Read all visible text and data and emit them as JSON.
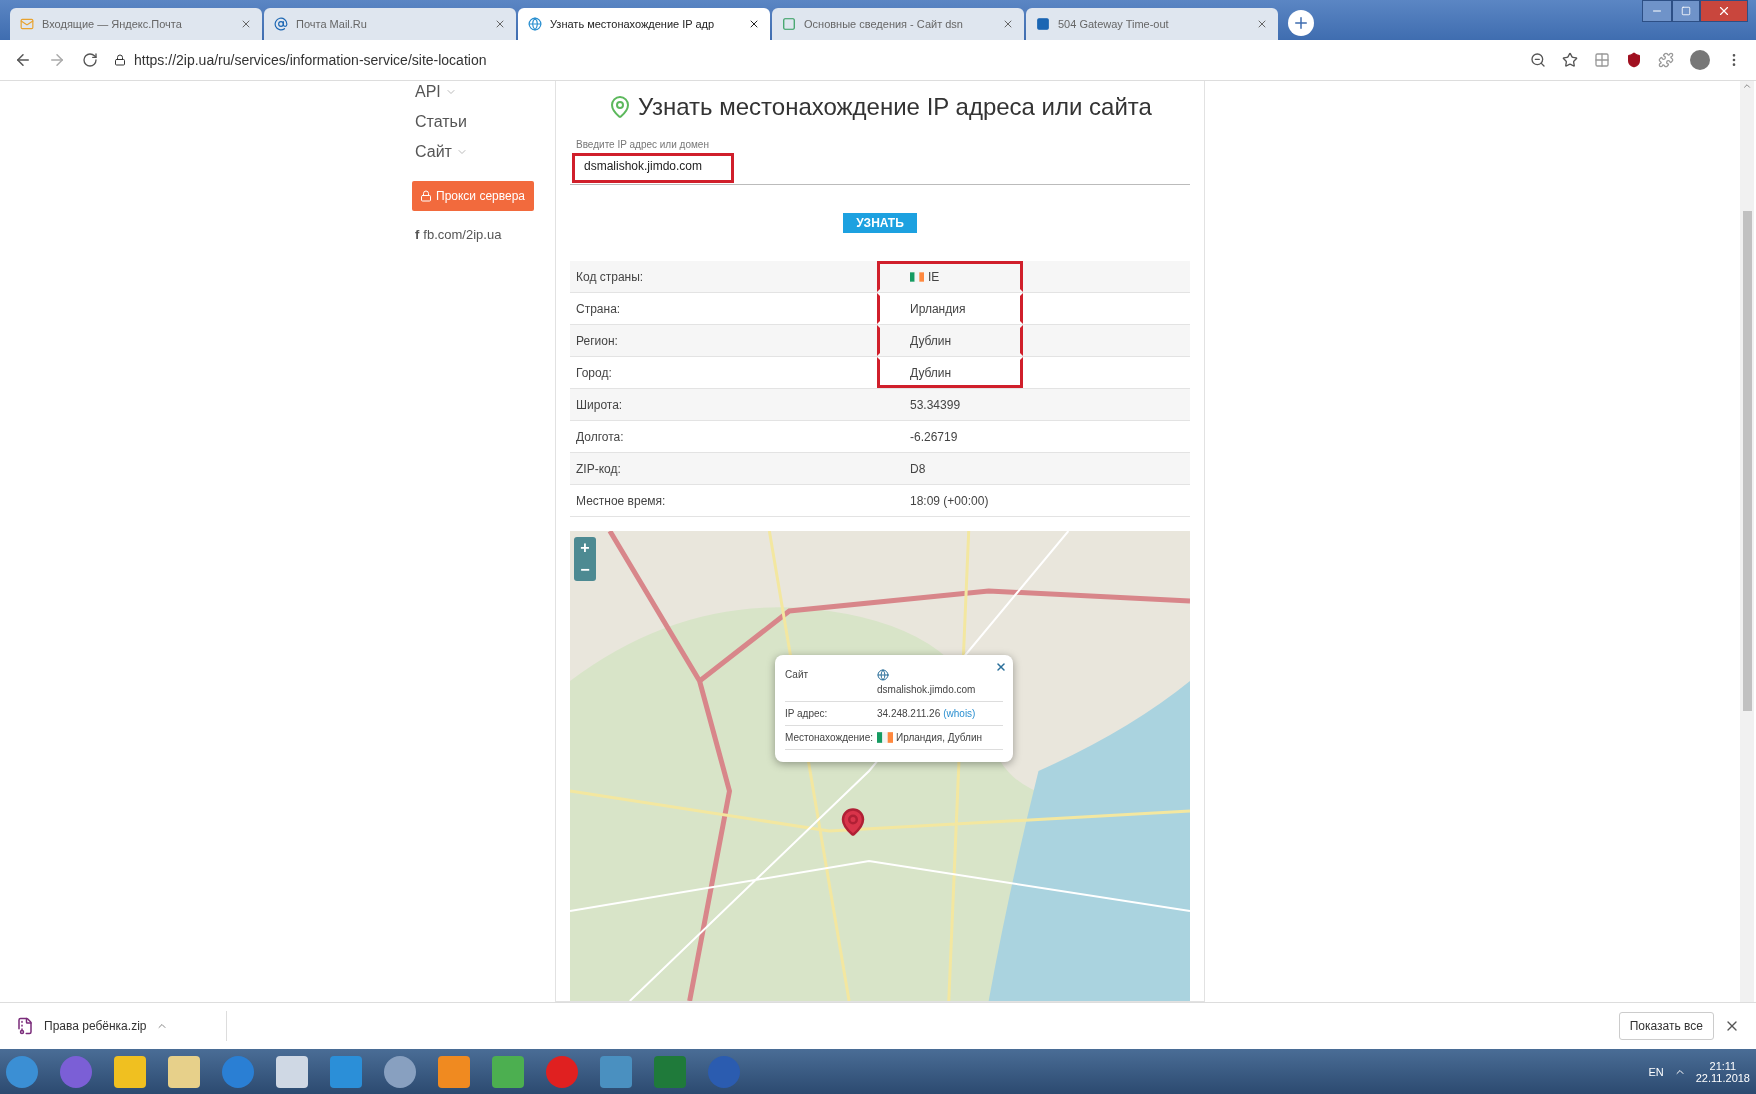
{
  "browser": {
    "tabs": [
      {
        "title": "Входящие — Яндекс.Почта",
        "selected": false
      },
      {
        "title": "Почта Mail.Ru",
        "selected": false
      },
      {
        "title": "Узнать местонахождение IP адр",
        "selected": true
      },
      {
        "title": "Основные сведения - Сайт dsn",
        "selected": false
      },
      {
        "title": "504 Gateway Time-out",
        "selected": false
      }
    ],
    "url": "https://2ip.ua/ru/services/information-service/site-location"
  },
  "sidebar": {
    "items": [
      {
        "label": "API",
        "kind": "dropdown"
      },
      {
        "label": "Статьи",
        "kind": "link"
      },
      {
        "label": "Сайт",
        "kind": "dropdown"
      }
    ],
    "proxy_button": "Прокси сервера",
    "social_icon": "f",
    "social_link": "fb.com/2ip.ua"
  },
  "card": {
    "title": "Узнать местонахождение IP адреса или сайта",
    "field": {
      "label": "Введите IP адрес или домен",
      "value": "dsmalishok.jimdo.com",
      "highlighted": true
    },
    "button": "УЗНАТЬ",
    "rows": [
      {
        "label": "Код страны:",
        "value": "IE",
        "kind": "flag",
        "highlighted": true
      },
      {
        "label": "Страна:",
        "value": "Ирландия",
        "kind": "text",
        "highlighted": true
      },
      {
        "label": "Регион:",
        "value": "Дублин",
        "kind": "text",
        "highlighted": true
      },
      {
        "label": "Город:",
        "value": "Дублин",
        "kind": "text",
        "highlighted": true
      },
      {
        "label": "Широта:",
        "value": "53.34399",
        "kind": "text",
        "highlighted": false
      },
      {
        "label": "Долгота:",
        "value": "-6.26719",
        "kind": "text",
        "highlighted": false
      },
      {
        "label": "ZIP-код:",
        "value": "D8",
        "kind": "text",
        "highlighted": false
      },
      {
        "label": "Местное время:",
        "value": "18:09 (+00:00)",
        "kind": "text",
        "highlighted": false
      }
    ]
  },
  "map": {
    "zoom_in": "+",
    "zoom_out": "−",
    "popup": {
      "rows": [
        {
          "label": "Сайт",
          "value": "dsmalishok.jimdo.com",
          "kind": "site"
        },
        {
          "label": "IP адрес:",
          "value": "34.248.211.26",
          "link": "(whois)",
          "kind": "ip"
        },
        {
          "label": "Местонахождение:",
          "value": "Ирландия, Дублин",
          "kind": "location"
        }
      ]
    }
  },
  "downloads": {
    "file": "Права ребёнка.zip",
    "show_all": "Показать все"
  },
  "taskbar": {
    "language": "EN",
    "time": "21:11",
    "date": "22.11.2018"
  }
}
